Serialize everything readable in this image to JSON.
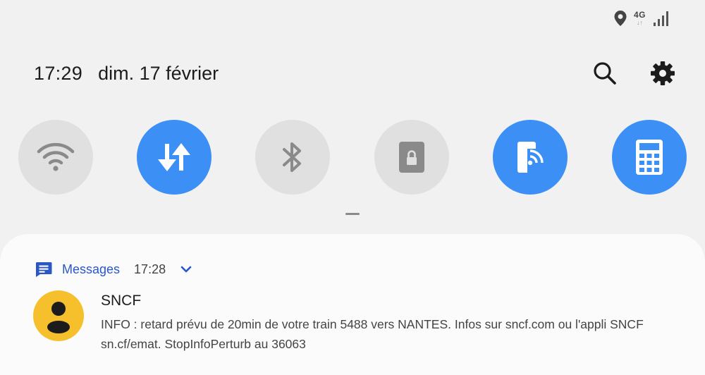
{
  "status_bar": {
    "icons": [
      "location-icon",
      "network-4g-icon",
      "signal-icon"
    ],
    "network_label": "4G",
    "network_arrows": "↓↑"
  },
  "header": {
    "time": "17:29",
    "date": "dim. 17 février",
    "actions": [
      "search-icon",
      "settings-gear-icon"
    ]
  },
  "quick_tiles": [
    {
      "name": "wifi",
      "icon": "wifi-icon",
      "state": "off"
    },
    {
      "name": "mobile-data",
      "icon": "data-transfer-icon",
      "state": "on"
    },
    {
      "name": "bluetooth",
      "icon": "bluetooth-icon",
      "state": "off"
    },
    {
      "name": "rotation-lock",
      "icon": "lock-icon",
      "state": "off"
    },
    {
      "name": "cast",
      "icon": "cast-icon",
      "state": "on"
    },
    {
      "name": "calculator",
      "icon": "calculator-icon",
      "state": "on"
    }
  ],
  "notification": {
    "app_icon": "messages-icon",
    "app_name": "Messages",
    "time": "17:28",
    "sender": "SNCF",
    "body": "INFO : retard prévu de 20min de votre train 5488 vers NANTES. Infos sur sncf.com ou l'appli SNCF sn.cf/emat. StopInfoPerturb au 36063",
    "avatar_icon": "person-icon"
  },
  "colors": {
    "background": "#f1f1f1",
    "tile_on": "#3b8ff5",
    "tile_off": "#e0e0e0",
    "app_name": "#2a56c6",
    "avatar": "#f6c02c"
  }
}
